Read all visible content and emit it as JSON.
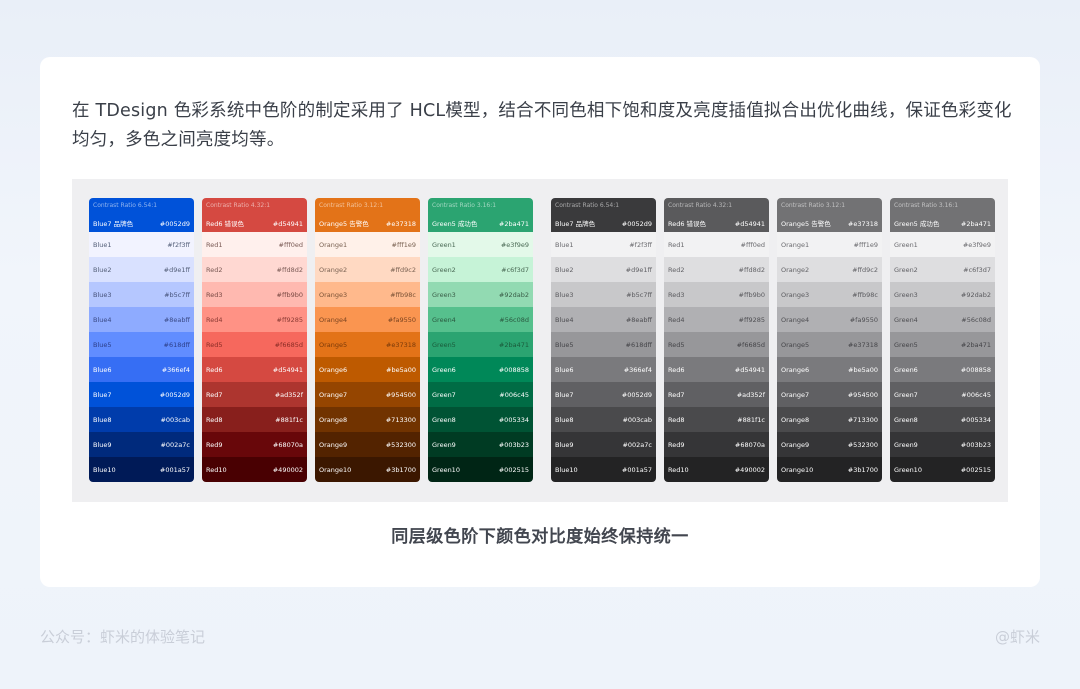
{
  "intro_text": "在 TDesign 色彩系统中色阶的制定采用了 HCL模型，结合不同色相下饱和度及亮度插值拟合出优化曲线，保证色彩变化均匀，多色之间亮度均等。",
  "caption": "同层级色阶下颜色对比度始终保持统一",
  "footer": {
    "left": "公众号：虾米的体验笔记",
    "right": "@虾米"
  },
  "color_columns": [
    {
      "ratio": "Contrast Ratio 6.54:1",
      "label": "Blue7 品牌色",
      "hex": "#0052d9",
      "head_bg": "#0052d9",
      "head_fg": "#ffffff",
      "steps": [
        {
          "name": "Blue1",
          "hex": "#f2f3ff",
          "bg": "#f2f3ff",
          "fg": "#55607a"
        },
        {
          "name": "Blue2",
          "hex": "#d9e1ff",
          "bg": "#d9e1ff",
          "fg": "#55607a"
        },
        {
          "name": "Blue3",
          "hex": "#b5c7ff",
          "bg": "#b5c7ff",
          "fg": "#46527a"
        },
        {
          "name": "Blue4",
          "hex": "#8eabff",
          "bg": "#8eabff",
          "fg": "#3a4a86"
        },
        {
          "name": "Blue5",
          "hex": "#618dff",
          "bg": "#618dff",
          "fg": "#2c3e88"
        },
        {
          "name": "Blue6",
          "hex": "#366ef4",
          "bg": "#366ef4",
          "fg": "#ffffff"
        },
        {
          "name": "Blue7",
          "hex": "#0052d9",
          "bg": "#0052d9",
          "fg": "#ffffff"
        },
        {
          "name": "Blue8",
          "hex": "#003cab",
          "bg": "#003cab",
          "fg": "#ffffff"
        },
        {
          "name": "Blue9",
          "hex": "#002a7c",
          "bg": "#002a7c",
          "fg": "#ffffff"
        },
        {
          "name": "Blue10",
          "hex": "#001a57",
          "bg": "#001a57",
          "fg": "#ffffff"
        }
      ]
    },
    {
      "ratio": "Contrast Ratio 4.32:1",
      "label": "Red6 错误色",
      "hex": "#d54941",
      "head_bg": "#d54941",
      "head_fg": "#ffffff",
      "steps": [
        {
          "name": "Red1",
          "hex": "#fff0ed",
          "bg": "#fff0ed",
          "fg": "#7a5a55"
        },
        {
          "name": "Red2",
          "hex": "#ffd8d2",
          "bg": "#ffd8d2",
          "fg": "#7a5a55"
        },
        {
          "name": "Red3",
          "hex": "#ffb9b0",
          "bg": "#ffb9b0",
          "fg": "#7a4a44"
        },
        {
          "name": "Red4",
          "hex": "#ff9285",
          "bg": "#ff9285",
          "fg": "#8a3a33"
        },
        {
          "name": "Red5",
          "hex": "#f6685d",
          "bg": "#f6685d",
          "fg": "#8a2c25"
        },
        {
          "name": "Red6",
          "hex": "#d54941",
          "bg": "#d54941",
          "fg": "#ffffff"
        },
        {
          "name": "Red7",
          "hex": "#ad352f",
          "bg": "#ad352f",
          "fg": "#ffffff"
        },
        {
          "name": "Red8",
          "hex": "#881f1c",
          "bg": "#881f1c",
          "fg": "#ffffff"
        },
        {
          "name": "Red9",
          "hex": "#68070a",
          "bg": "#68070a",
          "fg": "#ffffff"
        },
        {
          "name": "Red10",
          "hex": "#490002",
          "bg": "#490002",
          "fg": "#ffffff"
        }
      ]
    },
    {
      "ratio": "Contrast Ratio 3.12:1",
      "label": "Orange5 告警色",
      "hex": "#e37318",
      "head_bg": "#e37318",
      "head_fg": "#ffffff",
      "steps": [
        {
          "name": "Orange1",
          "hex": "#fff1e9",
          "bg": "#fff1e9",
          "fg": "#7a6252"
        },
        {
          "name": "Orange2",
          "hex": "#ffd9c2",
          "bg": "#ffd9c2",
          "fg": "#7a6252"
        },
        {
          "name": "Orange3",
          "hex": "#ffb98c",
          "bg": "#ffb98c",
          "fg": "#7a5236"
        },
        {
          "name": "Orange4",
          "hex": "#fa9550",
          "bg": "#fa9550",
          "fg": "#7a4420"
        },
        {
          "name": "Orange5",
          "hex": "#e37318",
          "bg": "#e37318",
          "fg": "#7a3a0a"
        },
        {
          "name": "Orange6",
          "hex": "#be5a00",
          "bg": "#be5a00",
          "fg": "#ffffff"
        },
        {
          "name": "Orange7",
          "hex": "#954500",
          "bg": "#954500",
          "fg": "#ffffff"
        },
        {
          "name": "Orange8",
          "hex": "#713300",
          "bg": "#713300",
          "fg": "#ffffff"
        },
        {
          "name": "Orange9",
          "hex": "#532300",
          "bg": "#532300",
          "fg": "#ffffff"
        },
        {
          "name": "Orange10",
          "hex": "#3b1700",
          "bg": "#3b1700",
          "fg": "#ffffff"
        }
      ]
    },
    {
      "ratio": "Contrast Ratio 3.16:1",
      "label": "Green5 成功色",
      "hex": "#2ba471",
      "head_bg": "#2ba471",
      "head_fg": "#ffffff",
      "steps": [
        {
          "name": "Green1",
          "hex": "#e3f9e9",
          "bg": "#e3f9e9",
          "fg": "#4a6a55"
        },
        {
          "name": "Green2",
          "hex": "#c6f3d7",
          "bg": "#c6f3d7",
          "fg": "#4a6a55"
        },
        {
          "name": "Green3",
          "hex": "#92dab2",
          "bg": "#92dab2",
          "fg": "#3a5e48"
        },
        {
          "name": "Green4",
          "hex": "#56c08d",
          "bg": "#56c08d",
          "fg": "#2a5a40"
        },
        {
          "name": "Green5",
          "hex": "#2ba471",
          "bg": "#2ba471",
          "fg": "#1a5a3a"
        },
        {
          "name": "Green6",
          "hex": "#008858",
          "bg": "#008858",
          "fg": "#ffffff"
        },
        {
          "name": "Green7",
          "hex": "#006c45",
          "bg": "#006c45",
          "fg": "#ffffff"
        },
        {
          "name": "Green8",
          "hex": "#005334",
          "bg": "#005334",
          "fg": "#ffffff"
        },
        {
          "name": "Green9",
          "hex": "#003b23",
          "bg": "#003b23",
          "fg": "#ffffff"
        },
        {
          "name": "Green10",
          "hex": "#002515",
          "bg": "#002515",
          "fg": "#ffffff"
        }
      ]
    }
  ],
  "gray_columns": [
    {
      "ratio": "Contrast Ratio 6.54:1",
      "label": "Blue7 品牌色",
      "hex": "#0052d9",
      "head_bg": "#3a3a3c",
      "head_fg": "#ffffff",
      "steps": [
        {
          "name": "Blue1",
          "hex": "#f2f3ff",
          "bg": "#f2f2f3",
          "fg": "#6a6a6e"
        },
        {
          "name": "Blue2",
          "hex": "#d9e1ff",
          "bg": "#dedee0",
          "fg": "#626266"
        },
        {
          "name": "Blue3",
          "hex": "#b5c7ff",
          "bg": "#c8c8ca",
          "fg": "#5a5a5e"
        },
        {
          "name": "Blue4",
          "hex": "#8eabff",
          "bg": "#b0b0b3",
          "fg": "#4e4e52"
        },
        {
          "name": "Blue5",
          "hex": "#618dff",
          "bg": "#97979a",
          "fg": "#444448"
        },
        {
          "name": "Blue6",
          "hex": "#366ef4",
          "bg": "#7a7a7d",
          "fg": "#ffffff"
        },
        {
          "name": "Blue7",
          "hex": "#0052d9",
          "bg": "#606063",
          "fg": "#ffffff"
        },
        {
          "name": "Blue8",
          "hex": "#003cab",
          "bg": "#4a4a4c",
          "fg": "#ffffff"
        },
        {
          "name": "Blue9",
          "hex": "#002a7c",
          "bg": "#353537",
          "fg": "#ffffff"
        },
        {
          "name": "Blue10",
          "hex": "#001a57",
          "bg": "#232324",
          "fg": "#ffffff"
        }
      ]
    },
    {
      "ratio": "Contrast Ratio 4.32:1",
      "label": "Red6 错误色",
      "hex": "#d54941",
      "head_bg": "#5a5a5c",
      "head_fg": "#ffffff",
      "steps": [
        {
          "name": "Red1",
          "hex": "#fff0ed",
          "bg": "#f2f2f3",
          "fg": "#6a6a6e"
        },
        {
          "name": "Red2",
          "hex": "#ffd8d2",
          "bg": "#dedee0",
          "fg": "#626266"
        },
        {
          "name": "Red3",
          "hex": "#ffb9b0",
          "bg": "#c8c8ca",
          "fg": "#5a5a5e"
        },
        {
          "name": "Red4",
          "hex": "#ff9285",
          "bg": "#b0b0b3",
          "fg": "#4e4e52"
        },
        {
          "name": "Red5",
          "hex": "#f6685d",
          "bg": "#97979a",
          "fg": "#444448"
        },
        {
          "name": "Red6",
          "hex": "#d54941",
          "bg": "#7a7a7d",
          "fg": "#ffffff"
        },
        {
          "name": "Red7",
          "hex": "#ad352f",
          "bg": "#606063",
          "fg": "#ffffff"
        },
        {
          "name": "Red8",
          "hex": "#881f1c",
          "bg": "#4a4a4c",
          "fg": "#ffffff"
        },
        {
          "name": "Red9",
          "hex": "#68070a",
          "bg": "#353537",
          "fg": "#ffffff"
        },
        {
          "name": "Red10",
          "hex": "#490002",
          "bg": "#232324",
          "fg": "#ffffff"
        }
      ]
    },
    {
      "ratio": "Contrast Ratio 3.12:1",
      "label": "Orange5 告警色",
      "hex": "#e37318",
      "head_bg": "#727274",
      "head_fg": "#ffffff",
      "steps": [
        {
          "name": "Orange1",
          "hex": "#fff1e9",
          "bg": "#f2f2f3",
          "fg": "#6a6a6e"
        },
        {
          "name": "Orange2",
          "hex": "#ffd9c2",
          "bg": "#dedee0",
          "fg": "#626266"
        },
        {
          "name": "Orange3",
          "hex": "#ffb98c",
          "bg": "#c8c8ca",
          "fg": "#5a5a5e"
        },
        {
          "name": "Orange4",
          "hex": "#fa9550",
          "bg": "#b0b0b3",
          "fg": "#4e4e52"
        },
        {
          "name": "Orange5",
          "hex": "#e37318",
          "bg": "#97979a",
          "fg": "#444448"
        },
        {
          "name": "Orange6",
          "hex": "#be5a00",
          "bg": "#7a7a7d",
          "fg": "#ffffff"
        },
        {
          "name": "Orange7",
          "hex": "#954500",
          "bg": "#606063",
          "fg": "#ffffff"
        },
        {
          "name": "Orange8",
          "hex": "#713300",
          "bg": "#4a4a4c",
          "fg": "#ffffff"
        },
        {
          "name": "Orange9",
          "hex": "#532300",
          "bg": "#353537",
          "fg": "#ffffff"
        },
        {
          "name": "Orange10",
          "hex": "#3b1700",
          "bg": "#232324",
          "fg": "#ffffff"
        }
      ]
    },
    {
      "ratio": "Contrast Ratio 3.16:1",
      "label": "Green5 成功色",
      "hex": "#2ba471",
      "head_bg": "#727274",
      "head_fg": "#ffffff",
      "steps": [
        {
          "name": "Green1",
          "hex": "#e3f9e9",
          "bg": "#f2f2f3",
          "fg": "#6a6a6e"
        },
        {
          "name": "Green2",
          "hex": "#c6f3d7",
          "bg": "#dedee0",
          "fg": "#626266"
        },
        {
          "name": "Green3",
          "hex": "#92dab2",
          "bg": "#c8c8ca",
          "fg": "#5a5a5e"
        },
        {
          "name": "Green4",
          "hex": "#56c08d",
          "bg": "#b0b0b3",
          "fg": "#4e4e52"
        },
        {
          "name": "Green5",
          "hex": "#2ba471",
          "bg": "#97979a",
          "fg": "#444448"
        },
        {
          "name": "Green6",
          "hex": "#008858",
          "bg": "#7a7a7d",
          "fg": "#ffffff"
        },
        {
          "name": "Green7",
          "hex": "#006c45",
          "bg": "#606063",
          "fg": "#ffffff"
        },
        {
          "name": "Green8",
          "hex": "#005334",
          "bg": "#4a4a4c",
          "fg": "#ffffff"
        },
        {
          "name": "Green9",
          "hex": "#003b23",
          "bg": "#353537",
          "fg": "#ffffff"
        },
        {
          "name": "Green10",
          "hex": "#002515",
          "bg": "#232324",
          "fg": "#ffffff"
        }
      ]
    }
  ]
}
